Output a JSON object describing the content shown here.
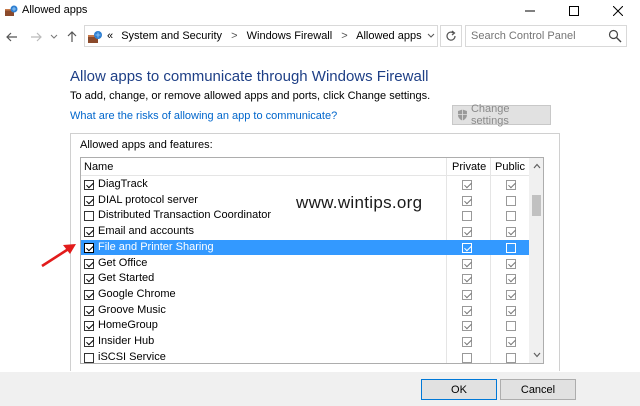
{
  "window": {
    "title": "Allowed apps"
  },
  "address": {
    "prefix": "«",
    "crumbs": [
      "System and Security",
      "Windows Firewall",
      "Allowed apps"
    ],
    "separator": ">"
  },
  "search": {
    "placeholder": "Search Control Panel"
  },
  "content": {
    "heading": "Allow apps to communicate through Windows Firewall",
    "description": "To add, change, or remove allowed apps and ports, click Change settings.",
    "risk_link": "What are the risks of allowing an app to communicate?",
    "change_settings_label": "Change settings",
    "group_label": "Allowed apps and features:"
  },
  "table": {
    "headers": {
      "name": "Name",
      "private": "Private",
      "public": "Public"
    },
    "rows": [
      {
        "name": "DiagTrack",
        "enabled": true,
        "private": true,
        "public": true,
        "selected": false
      },
      {
        "name": "DIAL protocol server",
        "enabled": true,
        "private": true,
        "public": false,
        "selected": false
      },
      {
        "name": "Distributed Transaction Coordinator",
        "enabled": false,
        "private": false,
        "public": false,
        "selected": false
      },
      {
        "name": "Email and accounts",
        "enabled": true,
        "private": true,
        "public": true,
        "selected": false
      },
      {
        "name": "File and Printer Sharing",
        "enabled": true,
        "private": true,
        "public": false,
        "selected": true
      },
      {
        "name": "Get Office",
        "enabled": true,
        "private": true,
        "public": true,
        "selected": false
      },
      {
        "name": "Get Started",
        "enabled": true,
        "private": true,
        "public": true,
        "selected": false
      },
      {
        "name": "Google Chrome",
        "enabled": true,
        "private": true,
        "public": true,
        "selected": false
      },
      {
        "name": "Groove Music",
        "enabled": true,
        "private": true,
        "public": true,
        "selected": false
      },
      {
        "name": "HomeGroup",
        "enabled": true,
        "private": true,
        "public": false,
        "selected": false
      },
      {
        "name": "Insider Hub",
        "enabled": true,
        "private": true,
        "public": true,
        "selected": false
      },
      {
        "name": "iSCSI Service",
        "enabled": false,
        "private": false,
        "public": false,
        "selected": false
      }
    ]
  },
  "footer": {
    "ok_label": "OK",
    "cancel_label": "Cancel"
  },
  "watermark": "www.wintips.org",
  "colors": {
    "heading": "#1e3f86",
    "link": "#0066cc",
    "selection": "#3399ff",
    "annotation_arrow": "#e21b1b"
  }
}
